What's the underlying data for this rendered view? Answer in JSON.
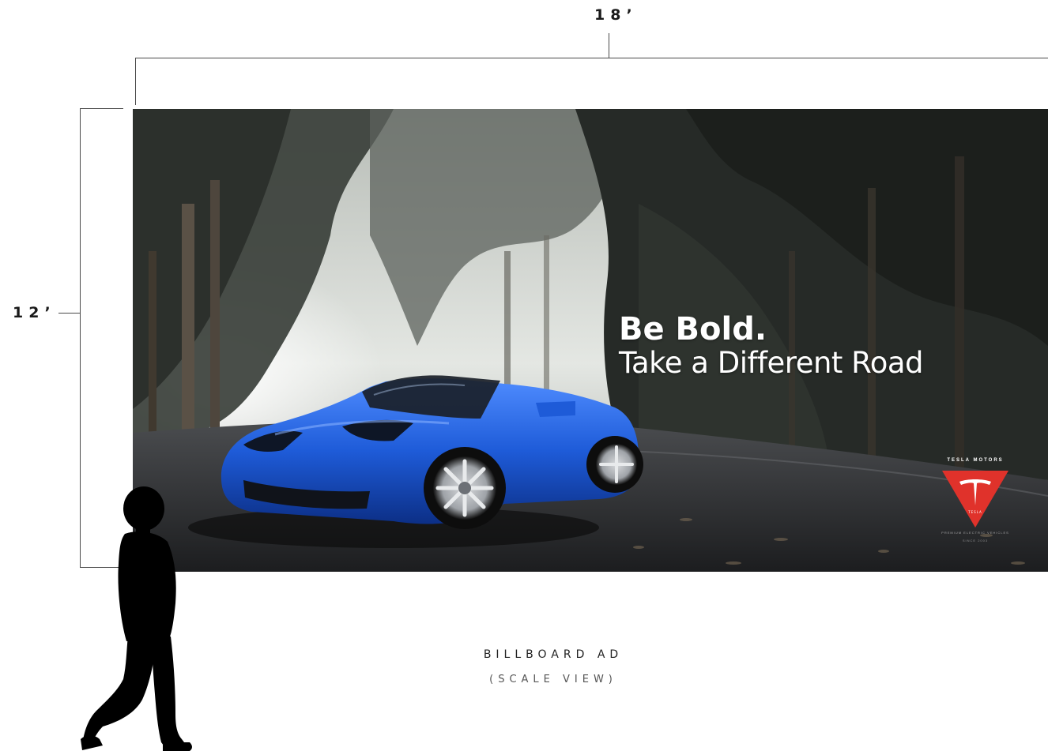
{
  "dimensions": {
    "width_label": "18’",
    "height_label": "12’"
  },
  "billboard": {
    "headline_primary": "Be Bold.",
    "headline_secondary": "Take a Different Road",
    "brand_wordmark": "TESLA MOTORS",
    "logo_text": "TESLA",
    "tagline": "PREMIUM ELECTRIC VEHICLES",
    "sub_tagline": "SINCE 2003",
    "colors": {
      "car": "#1e5bd8",
      "logo_red": "#e0322b",
      "road": "#2f3033",
      "foliage": "#2a2e2a"
    }
  },
  "caption": {
    "title": "BILLBOARD AD",
    "subtitle": "(SCALE VIEW)"
  },
  "icons": {
    "person": "person-silhouette-icon",
    "logo": "tesla-t-logo-icon"
  }
}
